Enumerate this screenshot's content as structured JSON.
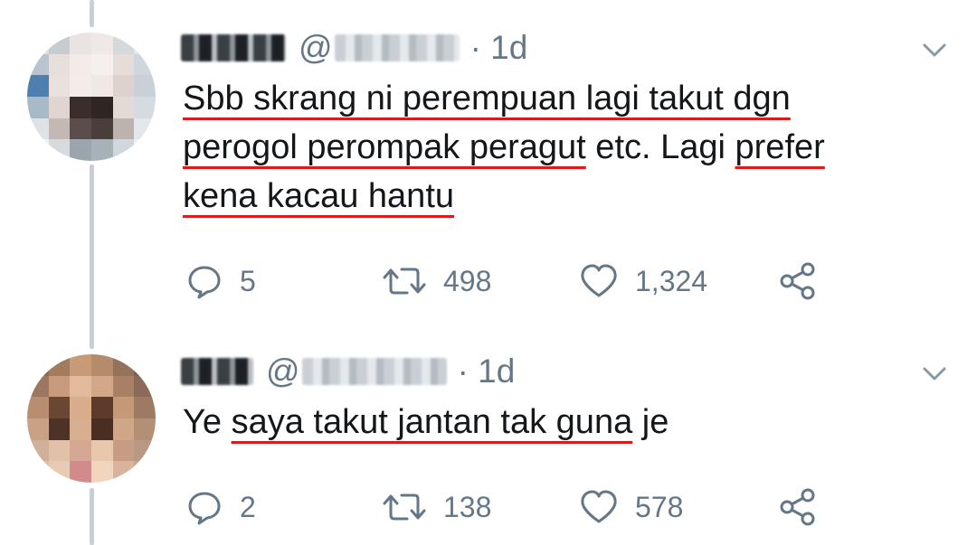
{
  "tweets": [
    {
      "name_hidden": true,
      "at_sign": "@",
      "time": "· 1d",
      "text_parts": [
        {
          "t": "Sbb skrang ni perempuan lagi takut dgn",
          "u": true
        },
        {
          "t": " ",
          "u": false
        },
        {
          "t": "perogol perompak peragut",
          "u": true
        },
        {
          "t": " etc. Lagi ",
          "u": false
        },
        {
          "t": "prefer",
          "u": true
        },
        {
          "t": " ",
          "u": false
        },
        {
          "t": "kena kacau hantu",
          "u": true
        }
      ],
      "reply_count": "5",
      "retweet_count": "498",
      "like_count": "1,324"
    },
    {
      "name_hidden": true,
      "at_sign": "@",
      "time": "· 1d",
      "text_parts": [
        {
          "t": "Ye ",
          "u": false
        },
        {
          "t": "saya takut jantan tak guna",
          "u": true
        },
        {
          "t": " je",
          "u": false
        }
      ],
      "reply_count": "2",
      "retweet_count": "138",
      "like_count": "578"
    }
  ],
  "icons": {
    "reply": "reply-icon",
    "retweet": "retweet-icon",
    "like": "heart-icon",
    "share": "share-icon",
    "menu": "chevron-down-icon"
  },
  "colors": {
    "text": "#14171a",
    "secondary": "#657786",
    "thread_line": "#c8d0d6",
    "underline": "#e0191b"
  }
}
